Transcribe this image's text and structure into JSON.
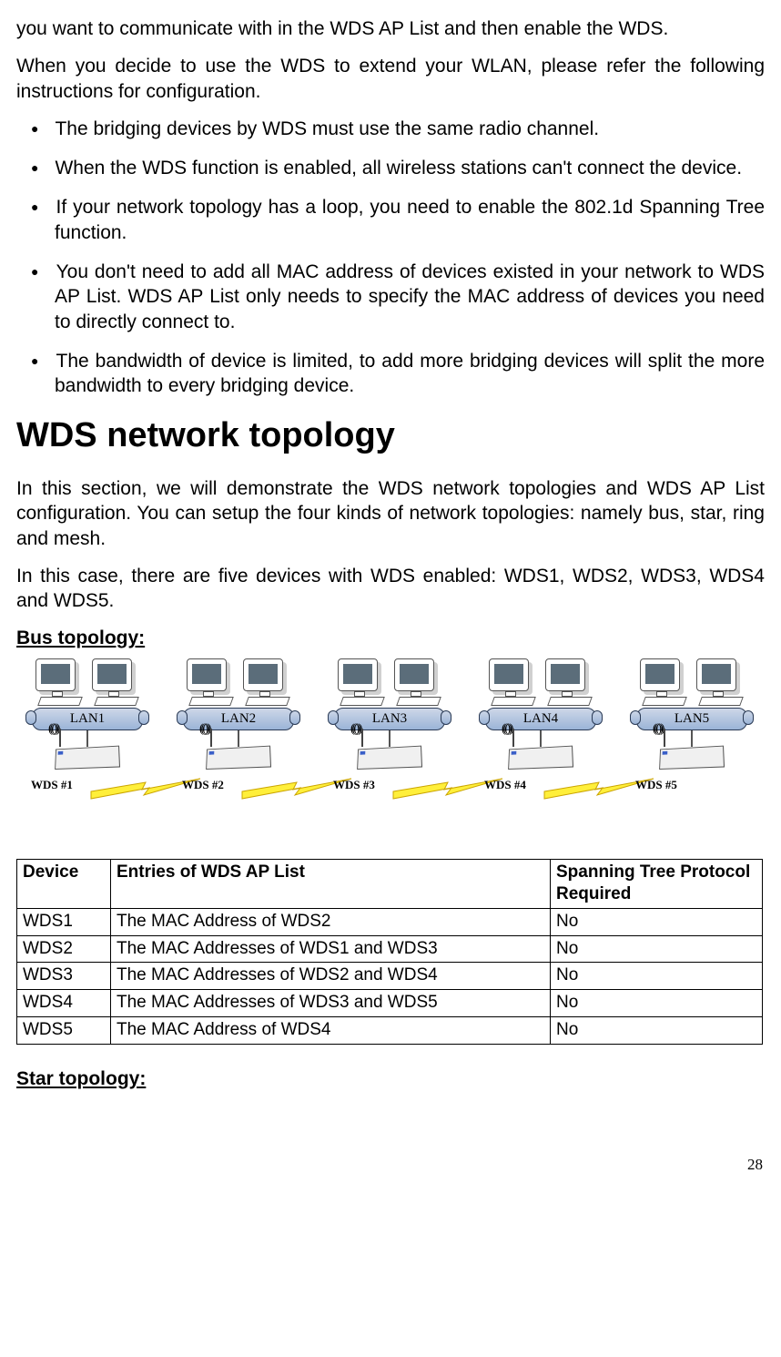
{
  "intro_tail": "you want to communicate with in the WDS AP List and then enable the WDS.",
  "para_decide": "When you decide to use the WDS to extend your WLAN, please refer the following instructions for configuration.",
  "bullets": [
    "The bridging devices by WDS must use the same radio channel.",
    "When the WDS function is enabled, all wireless stations can't connect the device.",
    "If your network topology has a loop, you need to enable the 802.1d Spanning Tree function.",
    "You don't need to add all MAC address of devices existed in your network to WDS AP List. WDS AP List only needs to specify the MAC address of devices you need to directly connect to.",
    "The bandwidth of device is limited, to add more bridging devices will split the more bandwidth to every bridging device."
  ],
  "heading": "WDS network topology",
  "para_section": "In this section, we will demonstrate the WDS network topologies and WDS AP List configuration. You can setup the four kinds of network topologies: namely bus, star, ring and mesh.",
  "para_case": "In this case, there are five devices with WDS enabled: WDS1, WDS2, WDS3, WDS4 and WDS5.",
  "bus_heading": "Bus topology:",
  "diagram": {
    "lans": [
      "LAN1",
      "LAN2",
      "LAN3",
      "LAN4",
      "LAN5"
    ],
    "wds": [
      "WDS #1",
      "WDS #2",
      "WDS #3",
      "WDS #4",
      "WDS #5"
    ]
  },
  "table": {
    "headers": {
      "device": "Device",
      "entries": "Entries of WDS AP List",
      "stp": "Spanning Tree Protocol Required"
    },
    "rows": [
      {
        "device": "WDS1",
        "entries": "The MAC Address of WDS2",
        "stp": "No"
      },
      {
        "device": "WDS2",
        "entries": "The MAC Addresses of WDS1 and WDS3",
        "stp": "No"
      },
      {
        "device": "WDS3",
        "entries": "The MAC Addresses of WDS2 and WDS4",
        "stp": "No"
      },
      {
        "device": "WDS4",
        "entries": "The MAC Addresses of WDS3 and WDS5",
        "stp": "No"
      },
      {
        "device": "WDS5",
        "entries": "The MAC Address of WDS4",
        "stp": "No"
      }
    ]
  },
  "star_heading": "Star topology:",
  "page_number": "28",
  "chart_data": {
    "type": "table",
    "title": "Bus topology WDS AP List",
    "columns": [
      "Device",
      "Entries of WDS AP List",
      "Spanning Tree Protocol Required"
    ],
    "rows": [
      [
        "WDS1",
        "The MAC Address of WDS2",
        "No"
      ],
      [
        "WDS2",
        "The MAC Addresses of WDS1 and WDS3",
        "No"
      ],
      [
        "WDS3",
        "The MAC Addresses of WDS2 and WDS4",
        "No"
      ],
      [
        "WDS4",
        "The MAC Addresses of WDS3 and WDS5",
        "No"
      ],
      [
        "WDS5",
        "The MAC Address of WDS4",
        "No"
      ]
    ]
  }
}
